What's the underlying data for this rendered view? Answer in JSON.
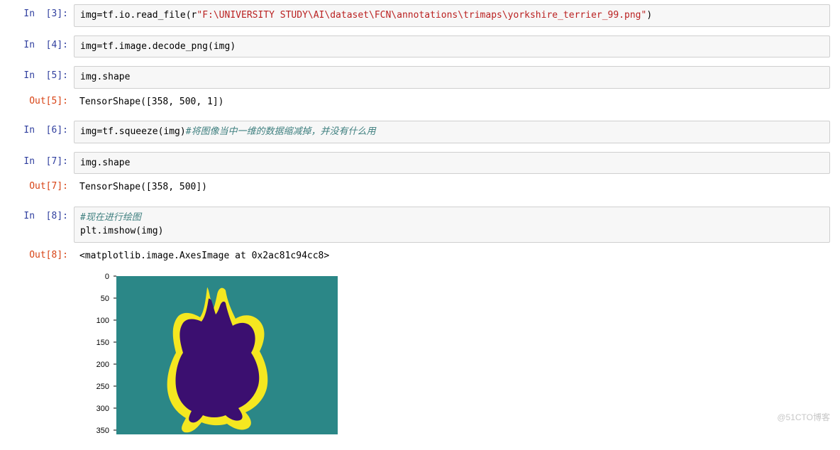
{
  "cells": {
    "c3": {
      "prompt_in": "In  [3]:",
      "code_prefix": "img=tf.io.read_file(",
      "code_r": "r",
      "code_str": "\"F:\\UNIVERSITY STUDY\\AI\\dataset\\FCN\\annotations\\trimaps\\yorkshire_terrier_99.png\"",
      "code_suffix": ")"
    },
    "c4": {
      "prompt_in": "In  [4]:",
      "code": "img=tf.image.decode_png(img)"
    },
    "c5": {
      "prompt_in": "In  [5]:",
      "code": "img.shape",
      "prompt_out": "Out[5]:",
      "output": "TensorShape([358, 500, 1])"
    },
    "c6": {
      "prompt_in": "In  [6]:",
      "code_prefix": "img=tf.squeeze(img)",
      "code_comment": "#将图像当中一维的数据缩减掉，并没有什么用"
    },
    "c7": {
      "prompt_in": "In  [7]:",
      "code": "img.shape",
      "prompt_out": "Out[7]:",
      "output": "TensorShape([358, 500])"
    },
    "c8": {
      "prompt_in": "In  [8]:",
      "code_comment": "#现在进行绘图",
      "code_line2": "plt.imshow(img)",
      "prompt_out": "Out[8]:",
      "output": "<matplotlib.image.AxesImage at 0x2ac81c94cc8>"
    }
  },
  "chart_data": {
    "type": "heatmap",
    "title": "",
    "xlabel": "",
    "ylabel": "",
    "xlim": [
      0,
      500
    ],
    "ylim": [
      358,
      0
    ],
    "yticks": [
      0,
      50,
      100,
      150,
      200,
      250,
      300,
      350
    ],
    "ytick_labels": [
      "0",
      "50",
      "100",
      "150",
      "200",
      "250",
      "300",
      "350"
    ],
    "colors": {
      "background": "#2b8787",
      "outline": "#f5e720",
      "foreground": "#3b0f70"
    },
    "description": "Trimap segmentation mask of a dog (yorkshire terrier): background=teal, foreground=dark purple silhouette, boundary=yellow outline"
  },
  "watermark": "@51CTO博客"
}
